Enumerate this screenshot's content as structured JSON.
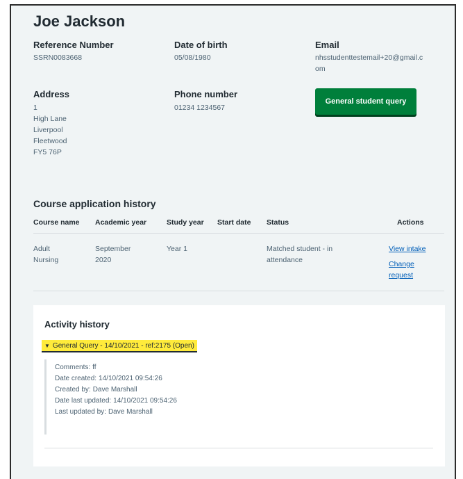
{
  "student": {
    "name": "Joe Jackson",
    "reference_label": "Reference Number",
    "reference_value": "SSRN0083668",
    "dob_label": "Date of birth",
    "dob_value": "05/08/1980",
    "email_label": "Email",
    "email_value_line1": "nhsstudenttestemail+20@gmail.c",
    "email_value_line2": "om",
    "address_label": "Address",
    "address_lines": [
      "1",
      "High Lane",
      "Liverpool",
      "Fleetwood",
      "FY5 76P"
    ],
    "phone_label": "Phone number",
    "phone_value": "01234 1234567",
    "query_button": "General student query"
  },
  "course_history": {
    "title": "Course application history",
    "headers": [
      "Course name",
      "Academic year",
      "Study year",
      "Start date",
      "Status",
      "Actions"
    ],
    "rows": [
      {
        "course_name": "Adult Nursing",
        "academic_year": "September 2020",
        "study_year": "Year 1",
        "start_date": "",
        "status": "Matched student - in attendance",
        "actions": [
          "View intake",
          "Change request"
        ]
      }
    ]
  },
  "activity": {
    "title": "Activity history",
    "summary": "General Query - 14/10/2021 - ref:2175 (Open)",
    "details": [
      {
        "label": "Comments:",
        "value": "ff"
      },
      {
        "label": "Date created:",
        "value": "14/10/2021 09:54:26"
      },
      {
        "label": "Created by:",
        "value": "Dave Marshall"
      },
      {
        "label": "Date last updated:",
        "value": "14/10/2021 09:54:26"
      },
      {
        "label": "Last updated by:",
        "value": "Dave Marshall"
      }
    ]
  },
  "colors": {
    "background": "#f0f4f5",
    "button": "#007f3b",
    "link": "#005eb8",
    "highlight": "#ffeb3b"
  },
  "icons": {
    "summary_caret": "caret-down-icon"
  }
}
